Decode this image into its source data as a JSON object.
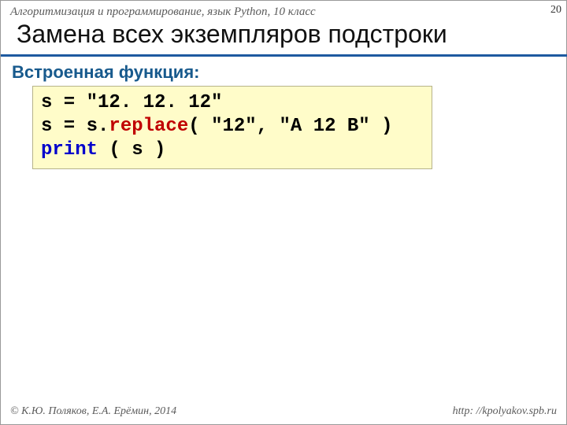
{
  "header": {
    "course": "Алгоритмизация и программирование, язык Python, 10 класс",
    "page": "20"
  },
  "title": "Замена всех экземпляров подстроки",
  "subhead": "Встроенная функция:",
  "code": {
    "l1_a": "s =",
    "l1_b": "\"12. 12. 12\"",
    "l2_a": "s = s.",
    "l2_fn": "replace",
    "l2_b": "(",
    "l2_c": "\"12\"",
    "l2_d": ",",
    "l2_e": "\"A 12 B\"",
    "l2_f": ")",
    "l3_kw": "print",
    "l3_b": "( s )"
  },
  "footer": {
    "left": "© К.Ю. Поляков, Е.А. Ерёмин, 2014",
    "right": "http: //kpolyakov.spb.ru"
  }
}
